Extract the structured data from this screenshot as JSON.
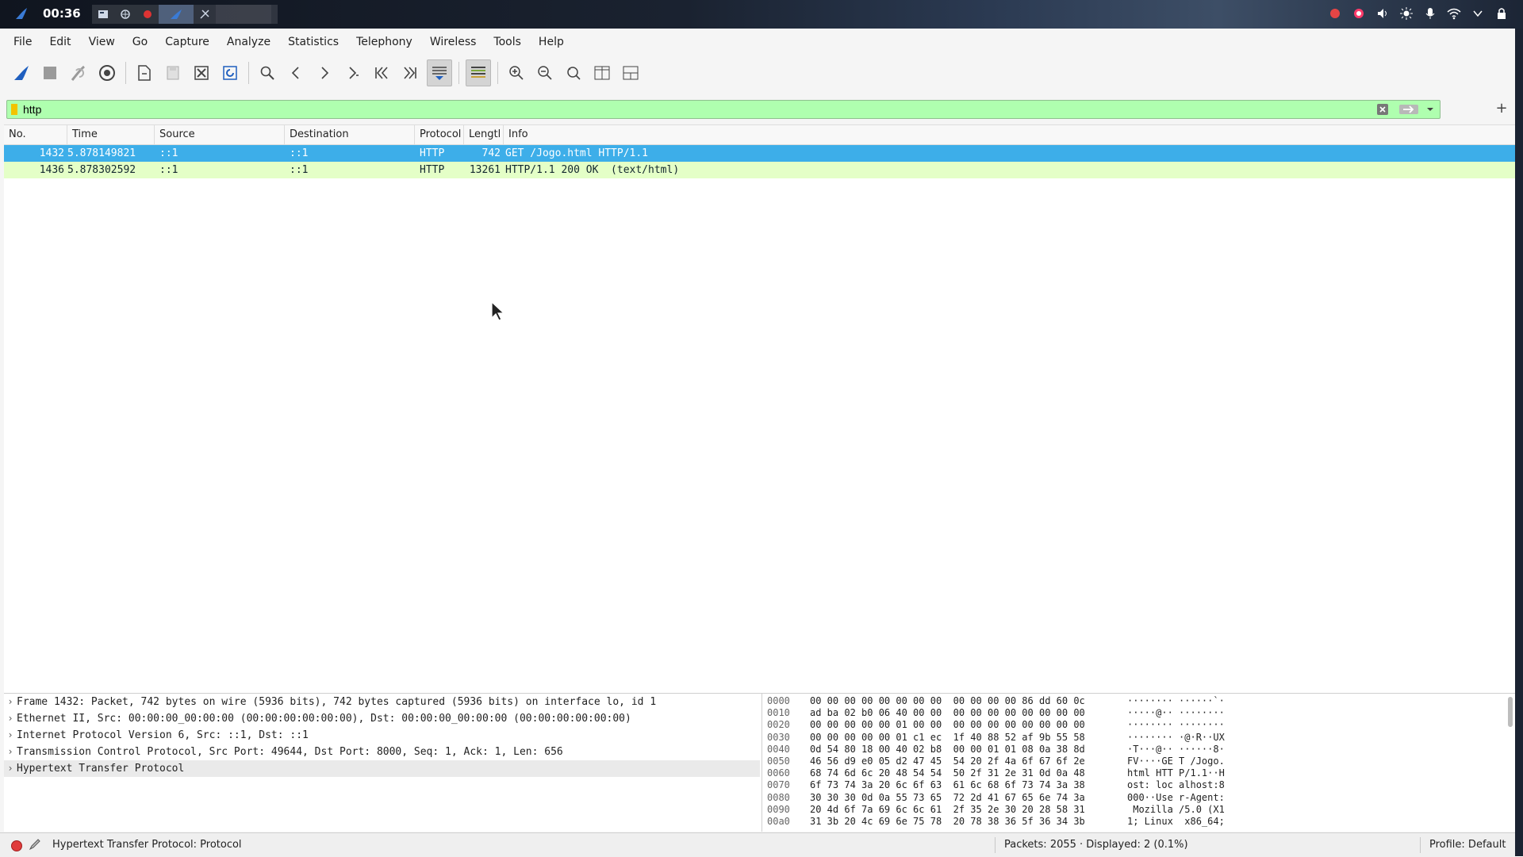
{
  "system_panel": {
    "clock": "00:36",
    "tray_icons": [
      "record-icon",
      "record-red-icon",
      "volume-icon",
      "brightness-icon",
      "microphone-icon",
      "wifi-icon",
      "chevron-down-icon",
      "lock-icon"
    ]
  },
  "menu": [
    "File",
    "Edit",
    "View",
    "Go",
    "Capture",
    "Analyze",
    "Statistics",
    "Telephony",
    "Wireless",
    "Tools",
    "Help"
  ],
  "filter": {
    "value": "http",
    "add_label": "+"
  },
  "packet_list": {
    "columns": [
      "No.",
      "Time",
      "Source",
      "Destination",
      "Protocol",
      "Lengtl",
      "Info"
    ],
    "rows": [
      {
        "no": "1432",
        "time": "5.878149821",
        "source": "::1",
        "destination": "::1",
        "protocol": "HTTP",
        "length": "742",
        "info": "GET /Jogo.html HTTP/1.1"
      },
      {
        "no": "1436",
        "time": "5.878302592",
        "source": "::1",
        "destination": "::1",
        "protocol": "HTTP",
        "length": "13261",
        "info": "HTTP/1.1 200 OK  (text/html)"
      }
    ]
  },
  "details": [
    "Frame 1432: Packet, 742 bytes on wire (5936 bits), 742 bytes captured (5936 bits) on interface lo, id 1",
    "Ethernet II, Src: 00:00:00_00:00:00 (00:00:00:00:00:00), Dst: 00:00:00_00:00:00 (00:00:00:00:00:00)",
    "Internet Protocol Version 6, Src: ::1, Dst: ::1",
    "Transmission Control Protocol, Src Port: 49644, Dst Port: 8000, Seq: 1, Ack: 1, Len: 656",
    "Hypertext Transfer Protocol"
  ],
  "bytes": [
    {
      "offset": "0000",
      "hex": "00 00 00 00 00 00 00 00  00 00 00 00 86 dd 60 0c",
      "ascii": "········ ······`·"
    },
    {
      "offset": "0010",
      "hex": "ad ba 02 b0 06 40 00 00  00 00 00 00 00 00 00 00",
      "ascii": "·····@·· ········"
    },
    {
      "offset": "0020",
      "hex": "00 00 00 00 00 01 00 00  00 00 00 00 00 00 00 00",
      "ascii": "········ ········"
    },
    {
      "offset": "0030",
      "hex": "00 00 00 00 00 01 c1 ec  1f 40 88 52 af 9b 55 58",
      "ascii": "········ ·@·R··UX"
    },
    {
      "offset": "0040",
      "hex": "0d 54 80 18 00 40 02 b8  00 00 01 01 08 0a 38 8d",
      "ascii": "·T···@·· ······8·"
    },
    {
      "offset": "0050",
      "hex": "46 56 d9 e0 05 d2 47 45  54 20 2f 4a 6f 67 6f 2e",
      "ascii": "FV····GE T /Jogo."
    },
    {
      "offset": "0060",
      "hex": "68 74 6d 6c 20 48 54 54  50 2f 31 2e 31 0d 0a 48",
      "ascii": "html HTT P/1.1··H"
    },
    {
      "offset": "0070",
      "hex": "6f 73 74 3a 20 6c 6f 63  61 6c 68 6f 73 74 3a 38",
      "ascii": "ost: loc alhost:8"
    },
    {
      "offset": "0080",
      "hex": "30 30 30 0d 0a 55 73 65  72 2d 41 67 65 6e 74 3a",
      "ascii": "000··Use r-Agent:"
    },
    {
      "offset": "0090",
      "hex": "20 4d 6f 7a 69 6c 6c 61  2f 35 2e 30 20 28 58 31",
      "ascii": " Mozilla /5.0 (X1"
    },
    {
      "offset": "00a0",
      "hex": "31 3b 20 4c 69 6e 75 78  20 78 38 36 5f 36 34 3b",
      "ascii": "1; Linux  x86_64;"
    }
  ],
  "status": {
    "text": "Hypertext Transfer Protocol: Protocol",
    "packets": "Packets: 2055 · Displayed: 2 (0.1%)",
    "profile": "Profile: Default"
  },
  "colors": {
    "selected_row": "#3daee9",
    "http_row": "#e4ffc7",
    "filter_valid": "#afffaf",
    "accent": "#1f5fbf"
  }
}
